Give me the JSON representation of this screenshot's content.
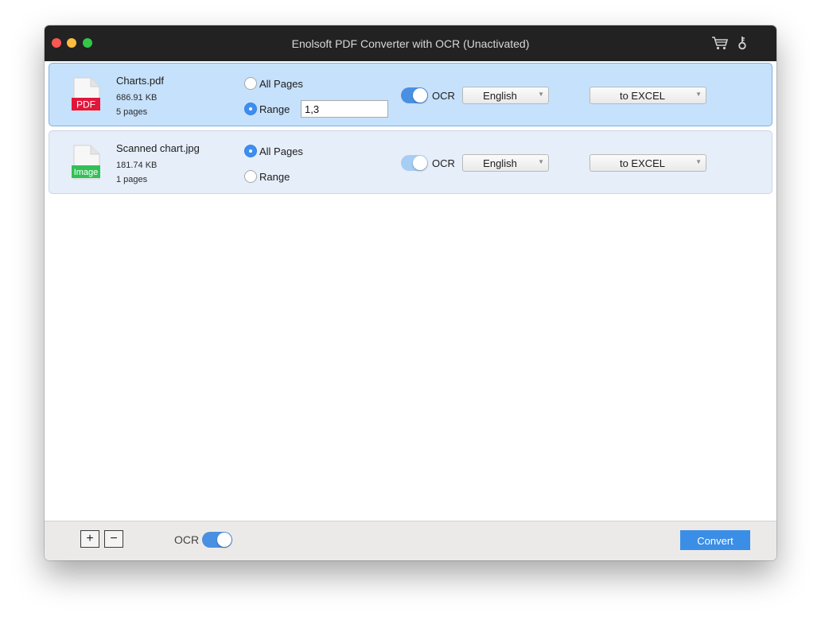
{
  "window": {
    "title": "Enolsoft PDF Converter with OCR (Unactivated)",
    "toolbar_icons": [
      "cart-icon",
      "key-icon"
    ]
  },
  "files": [
    {
      "name": "Charts.pdf",
      "size": "686.91 KB",
      "pages": "5 pages",
      "type_badge": "PDF",
      "badge_color": "#e0163a",
      "pages_option": "range",
      "all_pages_label": "All Pages",
      "range_label": "Range",
      "range_value": "1,3",
      "ocr_label": "OCR",
      "ocr_enabled": true,
      "language": "English",
      "output_format": "to EXCEL"
    },
    {
      "name": "Scanned chart.jpg",
      "size": "181.74 KB",
      "pages": "1 pages",
      "type_badge": "Image",
      "badge_color": "#32c057",
      "pages_option": "all",
      "all_pages_label": "All Pages",
      "range_label": "Range",
      "ocr_label": "OCR",
      "ocr_enabled": true,
      "language": "English",
      "output_format": "to EXCEL"
    }
  ],
  "footer": {
    "add_label": "+",
    "remove_label": "−",
    "ocr_label": "OCR",
    "ocr_enabled": true,
    "convert_label": "Convert"
  },
  "colors": {
    "accent": "#3a8ee6",
    "selected_row": "#c6e1fb",
    "row": "#e6eef9"
  }
}
